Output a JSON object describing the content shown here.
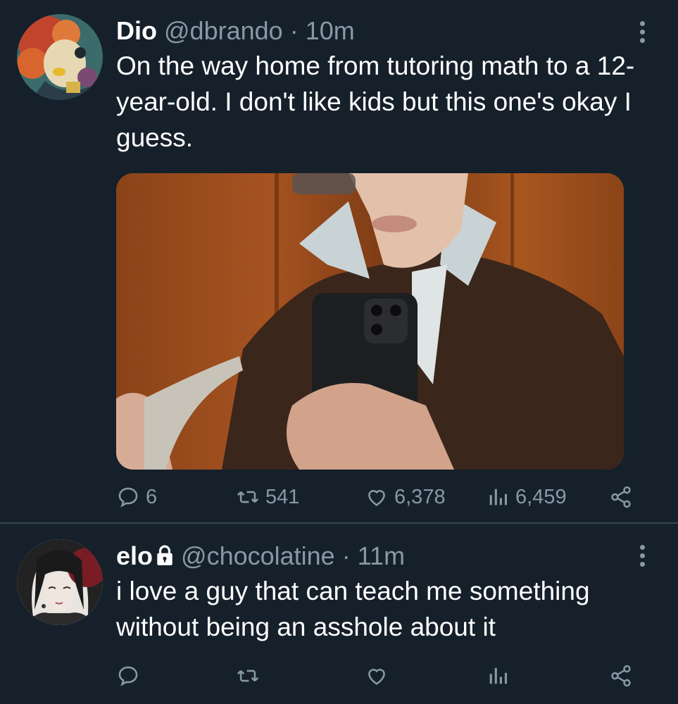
{
  "tweets": [
    {
      "author_name": "Dio",
      "author_handle": "@dbrando",
      "separator": "·",
      "time": "10m",
      "text": "On the way home from tutoring math to a 12-year-old. I don't like kids but this one's okay I guess.",
      "stats": {
        "replies": "6",
        "retweets": "541",
        "likes": "6,378",
        "views": "6,459"
      }
    },
    {
      "author_name": "elo",
      "author_handle": "@chocolatine",
      "separator": "·",
      "time": "11m",
      "text": "i love a guy that can teach me something without being an asshole about it",
      "locked": true
    }
  ],
  "colors": {
    "background": "#15202b",
    "muted": "#8899a6",
    "divider": "#38444d",
    "text": "#ffffff"
  },
  "icons": [
    "more-icon",
    "reply-icon",
    "retweet-icon",
    "like-icon",
    "views-icon",
    "share-icon",
    "lock-icon"
  ]
}
